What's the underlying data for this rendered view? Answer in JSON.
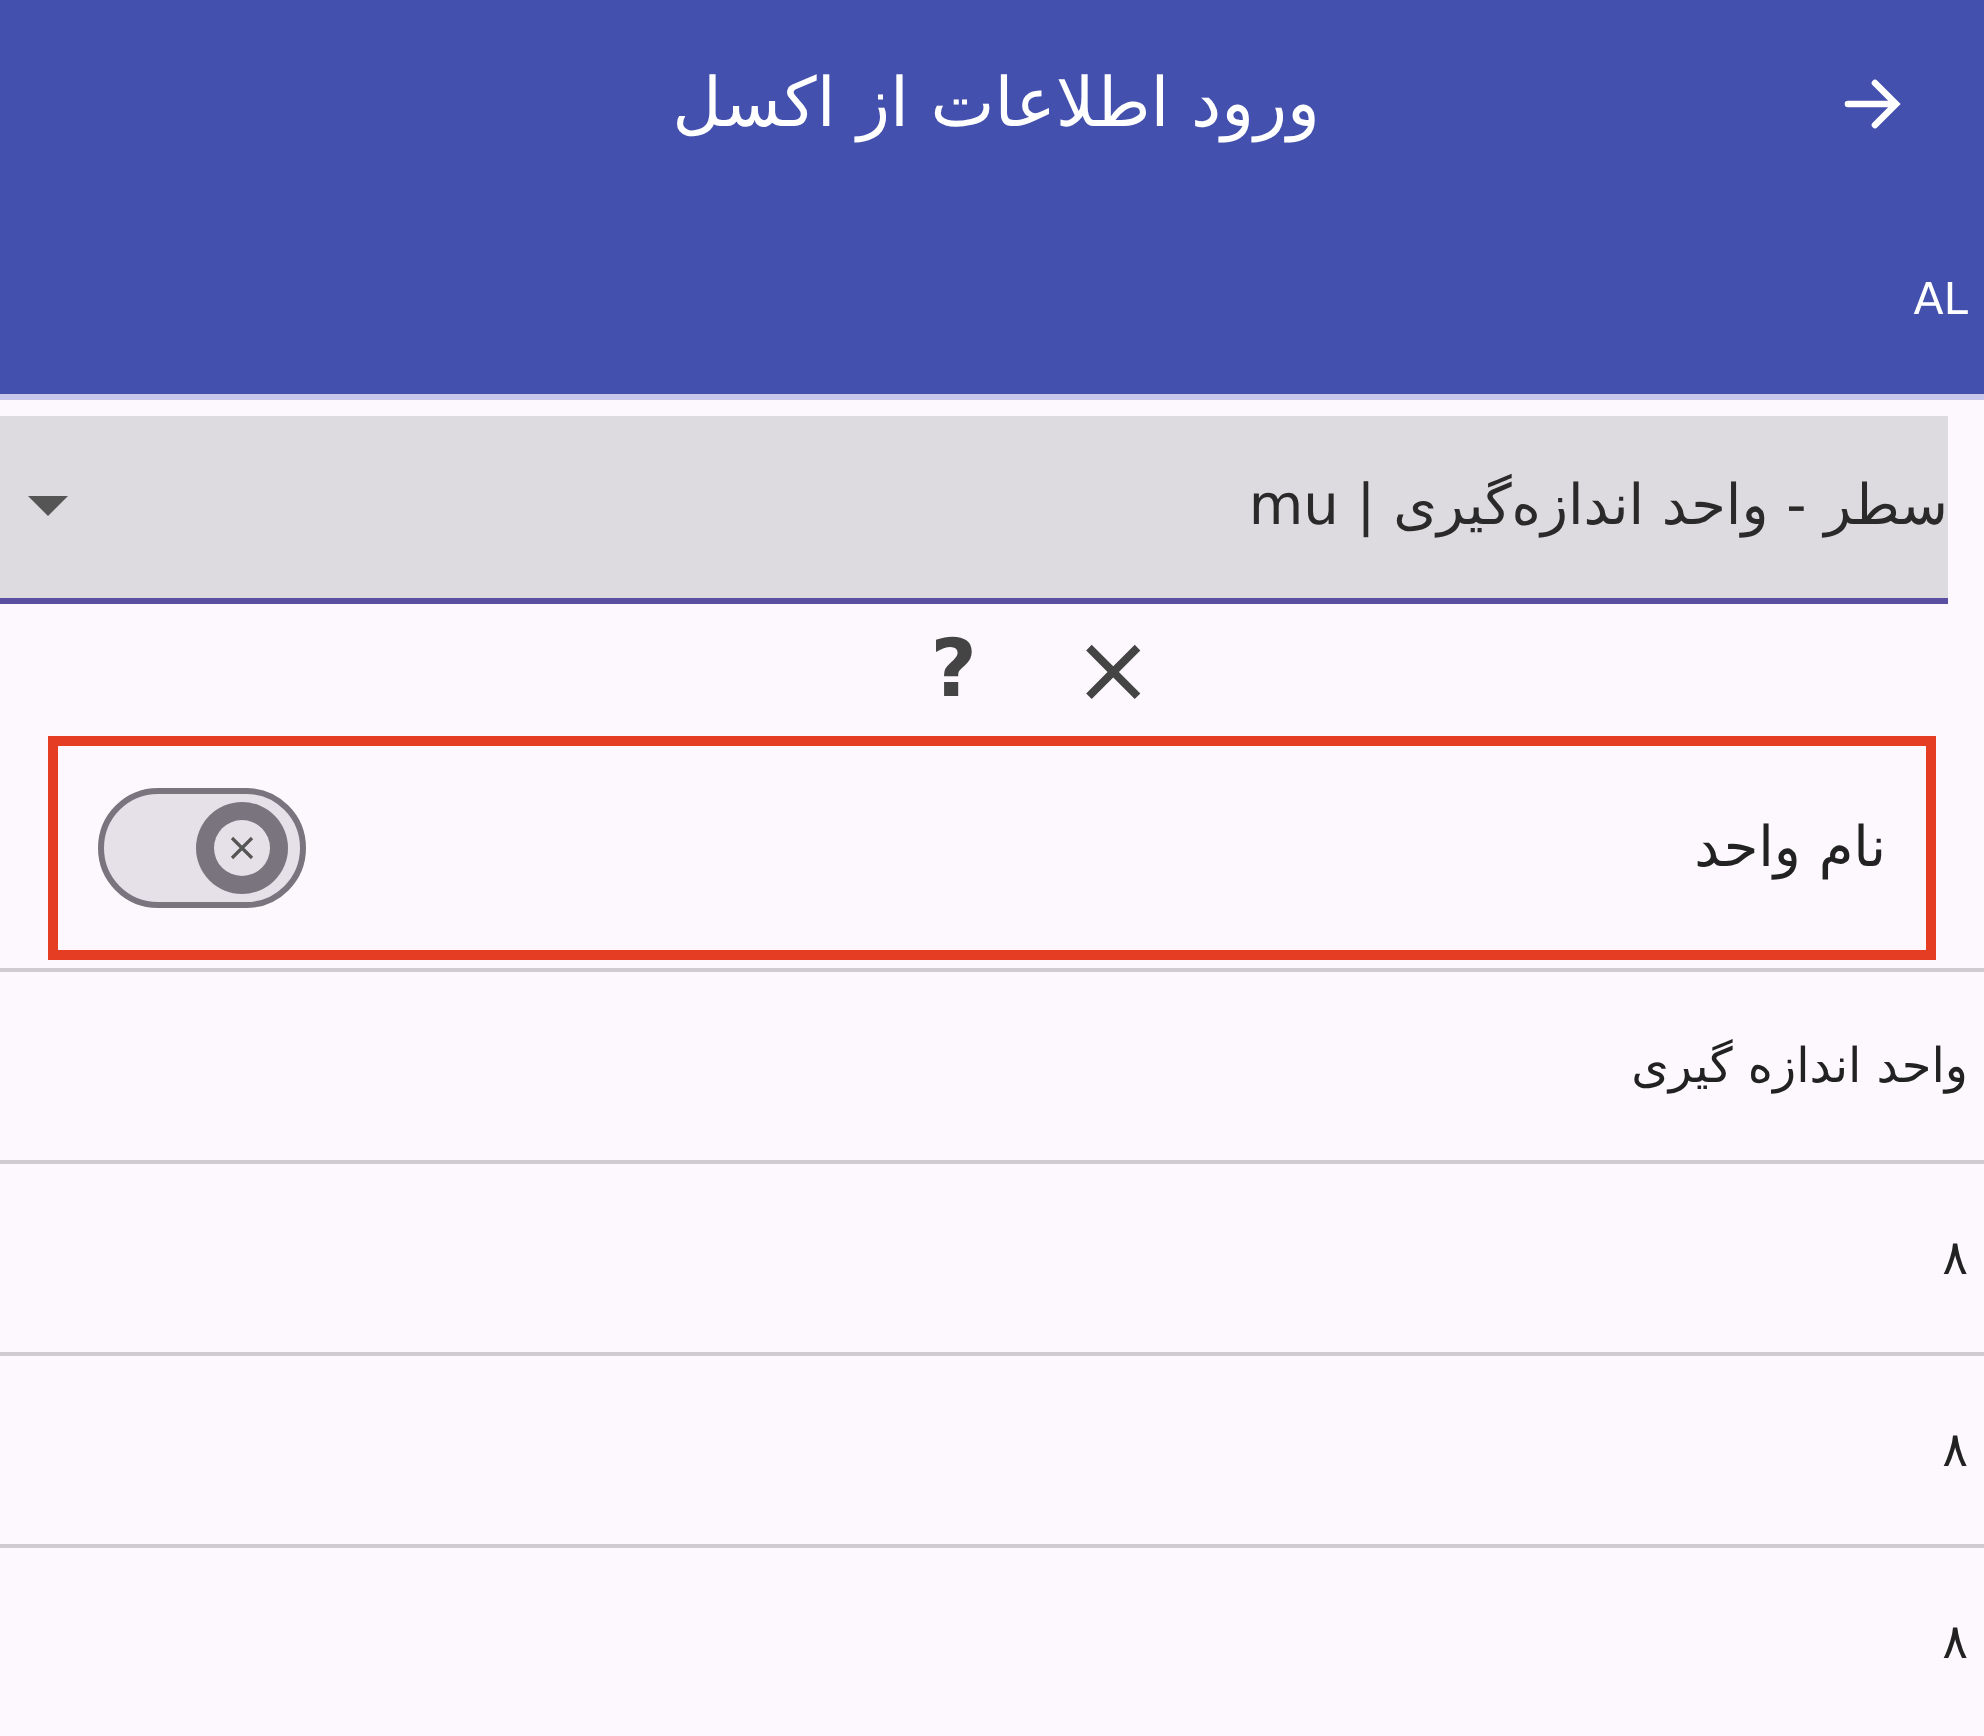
{
  "header": {
    "title": "ورود اطلاعات از اکسل",
    "badge": "AL"
  },
  "dropdown": {
    "value": "سطر - واحد اندازه‌گیری | mu"
  },
  "actions": [
    {
      "kind": "close",
      "text": "×"
    },
    {
      "kind": "help",
      "text": "?"
    }
  ],
  "field": {
    "label": "نام واحد",
    "on": false,
    "highlighted": true
  },
  "rows": [
    {
      "text": "واحد اندازه گیری"
    },
    {
      "text": "۸"
    },
    {
      "text": "۸"
    },
    {
      "text": "۸"
    }
  ]
}
